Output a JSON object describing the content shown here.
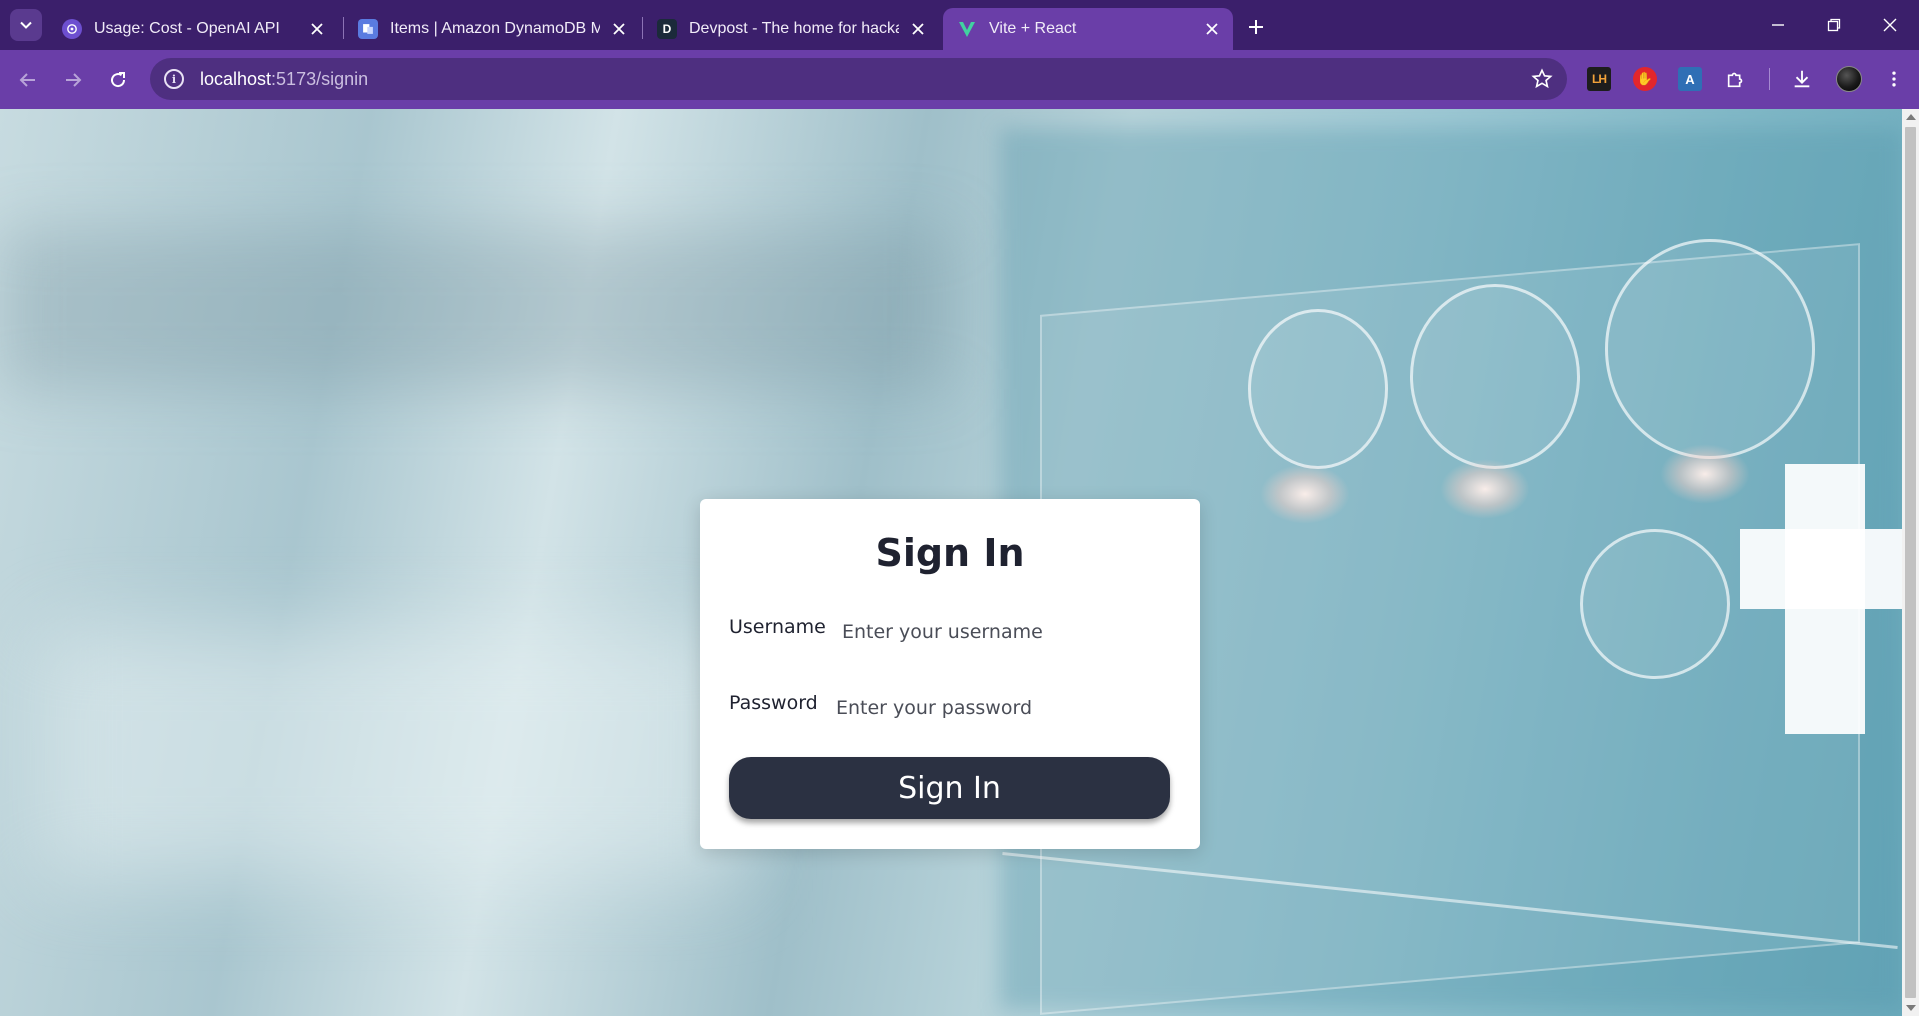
{
  "browser": {
    "tabs": [
      {
        "title": "Usage: Cost - OpenAI API",
        "favicon": "openai-icon",
        "active": false
      },
      {
        "title": "Items | Amazon DynamoDB Ma",
        "favicon": "dynamodb-icon",
        "active": false
      },
      {
        "title": "Devpost - The home for hackat",
        "favicon": "devpost-icon",
        "favicon_letter": "D",
        "active": false
      },
      {
        "title": "Vite + React",
        "favicon": "vite-icon",
        "active": true
      }
    ],
    "url_host": "localhost",
    "url_path": ":5173/signin",
    "extensions": [
      {
        "name": "lighthouse-extension-icon",
        "label": "LH"
      },
      {
        "name": "adblock-extension-icon",
        "label": "✋"
      },
      {
        "name": "docs-extension-icon",
        "label": "A"
      }
    ]
  },
  "signin": {
    "title": "Sign In",
    "username_label": "Username",
    "username_placeholder": "Enter your username",
    "username_value": "",
    "password_label": "Password",
    "password_placeholder": "Enter your password",
    "password_value": "",
    "submit_label": "Sign In"
  },
  "colors": {
    "tabstrip": "#3b1f6b",
    "toolbar": "#6a3ea8",
    "button": "#2b3142",
    "card": "#ffffff"
  }
}
